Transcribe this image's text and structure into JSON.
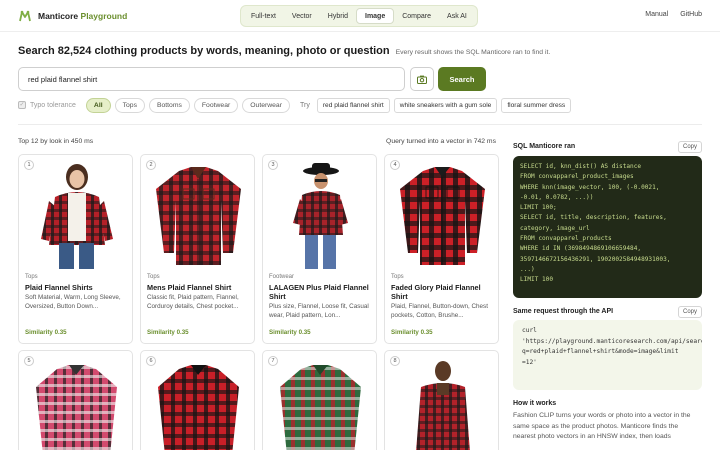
{
  "header": {
    "brand_prefix": "Manticore",
    "brand_suffix": "Playground",
    "tabs": [
      {
        "label": "Full-text",
        "active": false
      },
      {
        "label": "Vector",
        "active": false
      },
      {
        "label": "Hybrid",
        "active": false
      },
      {
        "label": "Image",
        "active": true
      },
      {
        "label": "Compare",
        "active": false
      },
      {
        "label": "Ask AI",
        "active": false
      }
    ],
    "links": [
      "Manual",
      "GitHub"
    ]
  },
  "headline": {
    "title": "Search 82,524 clothing products by words, meaning, photo or question",
    "subtitle": "Every result shows the SQL Manticore ran to find it."
  },
  "search": {
    "value": "red plaid flannel shirt",
    "button_label": "Search",
    "camera_icon": "camera-icon"
  },
  "filters": {
    "typo_label": "Typo tolerance",
    "typo_checked": false,
    "chips": [
      {
        "label": "All",
        "active": true
      },
      {
        "label": "Tops",
        "active": false
      },
      {
        "label": "Bottoms",
        "active": false
      },
      {
        "label": "Footwear",
        "active": false
      },
      {
        "label": "Outerwear",
        "active": false
      }
    ],
    "try_label": "Try",
    "try_examples": [
      "red plaid flannel shirt",
      "white sneakers with a gum sole",
      "floral summer dress"
    ]
  },
  "results": {
    "summary": "Top 12 by look in 450 ms",
    "vector_timing": "Query turned into a vector in 742 ms",
    "cards": [
      {
        "rank": "1",
        "category": "Tops",
        "title": "Plaid Flannel Shirts",
        "desc": "Soft Material, Warm, Long Sleeve, Oversized, Button Down...",
        "similarity": "Similarity 0.35",
        "photo": "woman-flannel"
      },
      {
        "rank": "2",
        "category": "Tops",
        "title": "Mens Plaid Flannel Shirt",
        "desc": "Classic fit, Plaid pattern, Flannel, Corduroy details, Chest pocket...",
        "similarity": "Similarity 0.35",
        "photo": "shirt-flat"
      },
      {
        "rank": "3",
        "category": "Footwear",
        "title": "LALAGEN Plus Plaid Flannel Shirt",
        "desc": "Plus size, Flannel, Loose fit, Casual wear, Plaid pattern, Lon...",
        "similarity": "Similarity 0.35",
        "photo": "woman-hat"
      },
      {
        "rank": "4",
        "category": "Tops",
        "title": "Faded Glory Plaid Flannel Shirt",
        "desc": "Plaid, Flannel, Button-down, Chest pockets, Cotton, Brushe...",
        "similarity": "Similarity 0.35",
        "photo": "shirt-flat-2"
      },
      {
        "rank": "5",
        "photo": "shirt-pink"
      },
      {
        "rank": "6",
        "photo": "shirt-red"
      },
      {
        "rank": "7",
        "photo": "shirt-green"
      },
      {
        "rank": "8",
        "photo": "person-shirt"
      }
    ]
  },
  "sql_panel": {
    "title": "SQL Manticore ran",
    "copy_label": "Copy",
    "code": "SELECT id, knn_dist() AS distance\nFROM convapparel_product_images\nWHERE knn(image_vector, 100, (-0.0021,\n-0.01, 0.0782, ...))\nLIMIT 100;\nSELECT id, title, description, features,\ncategory, image_url\nFROM convapparel_products\nWHERE id IN (3698494869106659484,\n3597146672156436291, 1902002584948931003,\n...)\nLIMIT 100"
  },
  "request_panel": {
    "title": "Same request through the API",
    "copy_label": "Copy",
    "code": "curl\n'https://playground.manticoresearch.com/api/search?\nq=red+plaid+flannel+shirt&mode=image&limit\n=12'"
  },
  "how_it_works": {
    "title": "How it works",
    "text": "Fashion CLIP turns your words or photo into a vector in the same space as the product photos. Manticore finds the nearest photo vectors in an HNSW index, then loads"
  },
  "colors": {
    "accent": "#5b7a22",
    "chip_active_bg": "#e6efc9",
    "code_bg": "#222a18",
    "code_text": "#c8dc8e",
    "shirt_red": "#c0242b",
    "shirt_black": "#1b1b1b"
  }
}
